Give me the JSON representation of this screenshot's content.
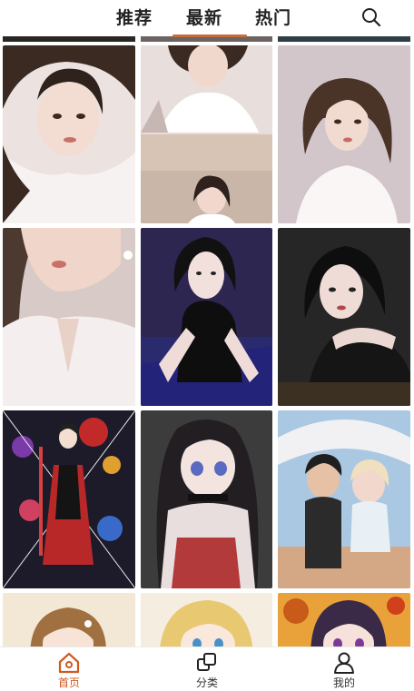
{
  "top_tabs": [
    {
      "label": "推荐",
      "active": false
    },
    {
      "label": "最新",
      "active": true
    },
    {
      "label": "热门",
      "active": false
    }
  ],
  "search": {
    "icon": "search-icon"
  },
  "grid": {
    "columns": 3,
    "tiles": [
      {
        "subject": "woman-portrait",
        "palette": [
          "#e9dedd",
          "#3a2a22"
        ]
      },
      {
        "subject": "woman-portrait-collage",
        "palette": [
          "#e8dedc",
          "#3a2a22"
        ]
      },
      {
        "subject": "woman-portrait",
        "palette": [
          "#cfc1c6",
          "#4a3428"
        ]
      },
      {
        "subject": "woman-portrait-closeup",
        "palette": [
          "#d8c8c4",
          "#4c3a30"
        ]
      },
      {
        "subject": "woman-dark-outfit",
        "palette": [
          "#3a2e6c",
          "#111111"
        ]
      },
      {
        "subject": "woman-dark-outfit",
        "palette": [
          "#2a2a2a",
          "#0e0e0e"
        ]
      },
      {
        "subject": "anime-girl-flowers",
        "palette": [
          "#1d1a2a",
          "#c22a2a"
        ]
      },
      {
        "subject": "anime-girl-scarf",
        "palette": [
          "#3c3c3c",
          "#e8dede"
        ]
      },
      {
        "subject": "anime-couple-beach",
        "palette": [
          "#aac8e2",
          "#2b2b2b"
        ]
      },
      {
        "subject": "anime-girl",
        "palette": [
          "#f3e7d6",
          "#a07040"
        ]
      },
      {
        "subject": "anime-girl-blonde",
        "palette": [
          "#f5ede0",
          "#e8c870"
        ]
      },
      {
        "subject": "anime-girl-autumn",
        "palette": [
          "#e9a23a",
          "#3a2a48"
        ]
      }
    ]
  },
  "bottom_nav": [
    {
      "label": "首页",
      "icon": "home-icon",
      "active": true
    },
    {
      "label": "分类",
      "icon": "category-icon",
      "active": false
    },
    {
      "label": "我的",
      "icon": "user-icon",
      "active": false
    }
  ],
  "colors": {
    "accent": "#d05a1e",
    "indicator": "#c86a3a",
    "text": "#222222"
  }
}
